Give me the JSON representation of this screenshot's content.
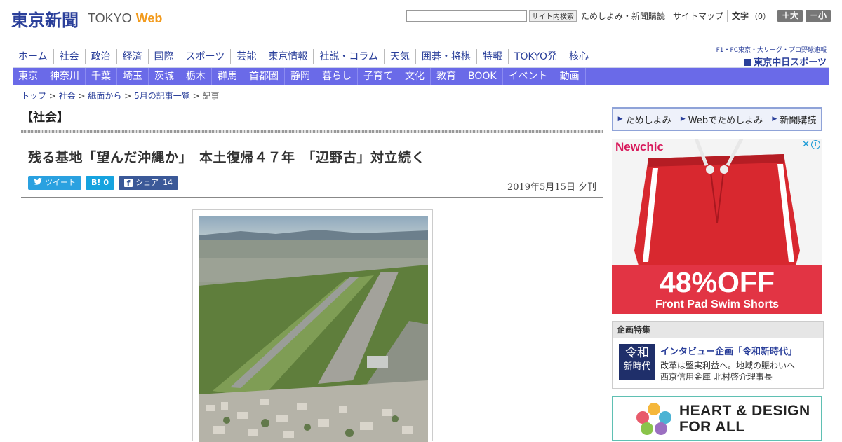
{
  "header": {
    "logo_jp": "東京新聞",
    "logo_en": "TOKYO",
    "logo_web": "Web",
    "search_button": "サイト内検索",
    "links": [
      "ためしよみ・新聞購読",
      "サイトマップ"
    ],
    "fontsize_label": "文字",
    "fontsize_value": "（0）",
    "bigger_label": "＋大",
    "smaller_label": "－小"
  },
  "main_nav": [
    "ホーム",
    "社会",
    "政治",
    "経済",
    "国際",
    "スポーツ",
    "芸能",
    "東京情報",
    "社説・コラム",
    "天気",
    "囲碁・将棋",
    "特報",
    "TOKYO発",
    "核心"
  ],
  "chunichi": {
    "top": "F1・FC東京・大リーグ・プロ野球速報",
    "logo": "東京中日スポーツ"
  },
  "region_nav": [
    "東京",
    "神奈川",
    "千葉",
    "埼玉",
    "茨城",
    "栃木",
    "群馬",
    "首都圏",
    "静岡",
    "暮らし",
    "子育て",
    "文化",
    "教育",
    "BOOK",
    "イベント",
    "動画"
  ],
  "breadcrumb": {
    "items": [
      "トップ",
      "社会",
      "紙面から",
      "5月の記事一覧"
    ],
    "current": "記事",
    "sep": " > "
  },
  "article": {
    "section": "【社会】",
    "headline": "残る基地「望んだ沖縄か」　本土復帰４７年　「辺野古」対立続く",
    "date": "2019年5月15日 夕刊",
    "share": {
      "tweet": "ツイート",
      "hatena_icon": "B!",
      "hatena_count": "0",
      "fb_label": "シェア",
      "fb_count": "14"
    }
  },
  "sidebar": {
    "trial_links": [
      "ためしよみ",
      "Webでためしよみ",
      "新聞購読"
    ],
    "ad": {
      "brand": "Newchic",
      "headline": "48%OFF",
      "sub": "Front Pad Swim Shorts"
    },
    "feature": {
      "heading": "企画特集",
      "thumb_line1": "令和",
      "thumb_line2": "新時代",
      "title": "インタビュー企画「令和新時代」",
      "desc_line1": "改革は堅実利益へ。地域の賑わいへ",
      "desc_line2": "西京信用金庫 北村啓介理事長"
    },
    "hd": {
      "line1": "HEART & DESIGN",
      "line2": "FOR ALL"
    }
  },
  "colors": {
    "brand_blue": "#2a3f9a",
    "region_nav": "#6a6ae8",
    "web_orange": "#f29a1b",
    "ad_red": "#e23444"
  }
}
